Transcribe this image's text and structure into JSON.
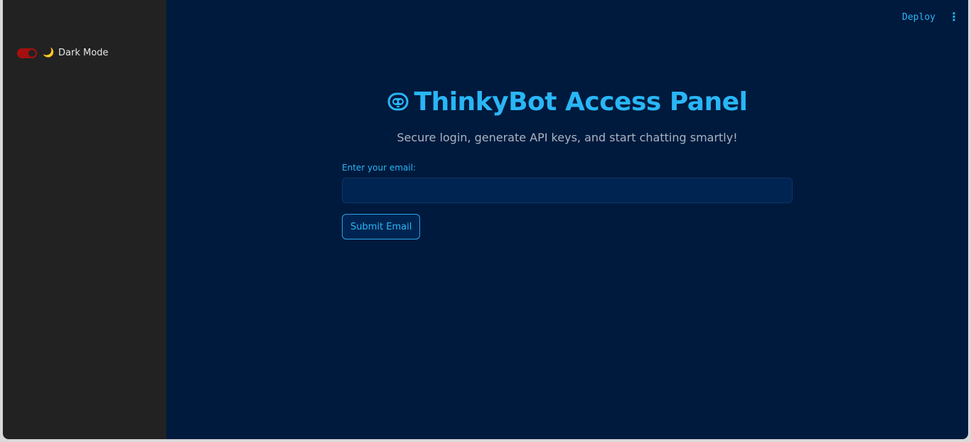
{
  "sidebar": {
    "dark_mode_toggle": {
      "icon": "moon-icon",
      "label": "Dark Mode",
      "on": true
    }
  },
  "header": {
    "deploy_label": "Deploy",
    "menu_icon": "kebab-menu-icon"
  },
  "main": {
    "title_icon": "robot-face-icon",
    "title": "ThinkyBot Access Panel",
    "subtitle": "Secure login, generate API keys, and start chatting smartly!",
    "email_label": "Enter your email:",
    "email_value": "",
    "email_placeholder": "",
    "submit_label": "Submit Email"
  },
  "colors": {
    "sidebar_bg": "#222222",
    "main_bg": "#001a3d",
    "accent": "#29b6f6",
    "toggle_on": "#a50f0f",
    "input_bg": "#002451"
  }
}
